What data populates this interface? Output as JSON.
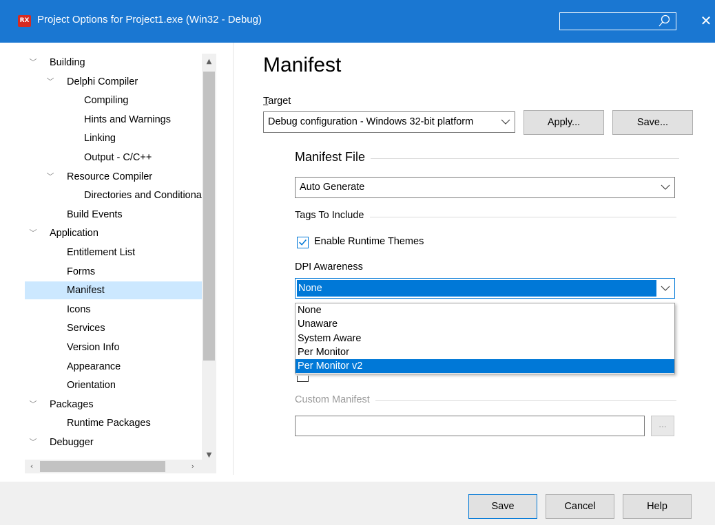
{
  "window": {
    "title": "Project Options for Project1.exe  (Win32 - Debug)",
    "icon_text": "RX",
    "search_value": "",
    "close_glyph": "✕"
  },
  "colors": {
    "titlebar": "#1a77d2",
    "selection": "#cce8ff",
    "highlight": "#0078d7"
  },
  "tree": {
    "items": [
      {
        "label": "Building",
        "level": 0,
        "expandable": true
      },
      {
        "label": "Delphi Compiler",
        "level": 1,
        "expandable": true
      },
      {
        "label": "Compiling",
        "level": 2,
        "expandable": false
      },
      {
        "label": "Hints and Warnings",
        "level": 2,
        "expandable": false
      },
      {
        "label": "Linking",
        "level": 2,
        "expandable": false
      },
      {
        "label": "Output - C/C++",
        "level": 2,
        "expandable": false
      },
      {
        "label": "Resource Compiler",
        "level": 1,
        "expandable": true
      },
      {
        "label": "Directories and Conditionals",
        "level": 2,
        "expandable": false
      },
      {
        "label": "Build Events",
        "level": 1,
        "expandable": false
      },
      {
        "label": "Application",
        "level": 0,
        "expandable": true
      },
      {
        "label": "Entitlement List",
        "level": 1,
        "expandable": false
      },
      {
        "label": "Forms",
        "level": 1,
        "expandable": false
      },
      {
        "label": "Manifest",
        "level": 1,
        "expandable": false,
        "selected": true
      },
      {
        "label": "Icons",
        "level": 1,
        "expandable": false
      },
      {
        "label": "Services",
        "level": 1,
        "expandable": false
      },
      {
        "label": "Version Info",
        "level": 1,
        "expandable": false
      },
      {
        "label": "Appearance",
        "level": 1,
        "expandable": false
      },
      {
        "label": "Orientation",
        "level": 1,
        "expandable": false
      },
      {
        "label": "Packages",
        "level": 0,
        "expandable": true
      },
      {
        "label": "Runtime Packages",
        "level": 1,
        "expandable": false
      },
      {
        "label": "Debugger",
        "level": 0,
        "expandable": true
      }
    ]
  },
  "main": {
    "heading": "Manifest",
    "target_label": "Target",
    "target_value": "Debug configuration - Windows 32-bit platform",
    "apply_label": "Apply...",
    "save_target_label": "Save...",
    "manifest_file_title": "Manifest File",
    "manifest_mode_value": "Auto Generate",
    "tags_title": "Tags To Include",
    "enable_themes_label": "Enable Runtime Themes",
    "enable_themes_checked": true,
    "dpi_label": "DPI Awareness",
    "dpi_value": "None",
    "dpi_options": [
      "None",
      "Unaware",
      "System Aware",
      "Per Monitor",
      "Per Monitor v2"
    ],
    "dpi_highlighted": "Per Monitor v2",
    "custom_manifest_title": "Custom Manifest",
    "custom_manifest_value": "",
    "browse_label": "..."
  },
  "footer": {
    "save_label": "Save",
    "cancel_label": "Cancel",
    "help_label": "Help"
  }
}
